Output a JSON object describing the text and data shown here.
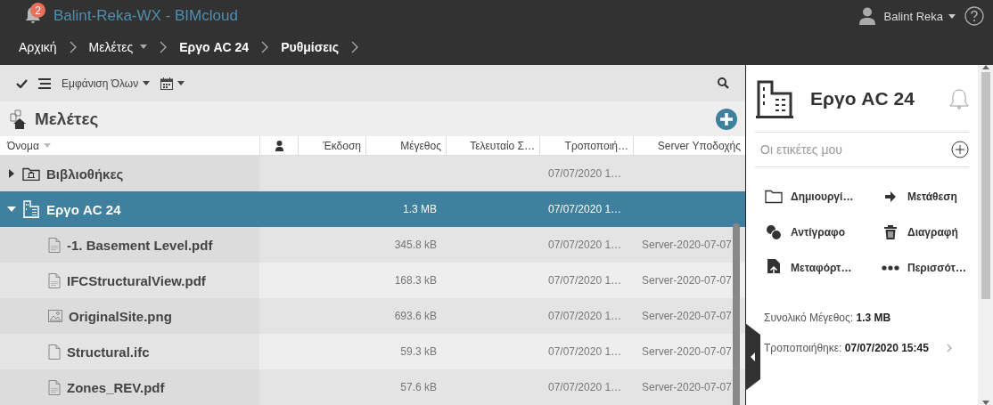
{
  "header": {
    "notification_count": "2",
    "title": "Balint-Reka-WX - BIMcloud",
    "user": "Balint Reka"
  },
  "breadcrumbs": [
    {
      "label": "Αρχική",
      "emphasized": false,
      "dropdown": false
    },
    {
      "label": "Μελέτες",
      "emphasized": false,
      "dropdown": true
    },
    {
      "label": "Εργο AC 24",
      "emphasized": true,
      "dropdown": false
    },
    {
      "label": "Ρυθμίσεις",
      "emphasized": true,
      "dropdown": false
    }
  ],
  "toolbar": {
    "filter": "Εμφάνιση Όλων"
  },
  "list": {
    "title": "Μελέτες",
    "columns": [
      {
        "kind": "text",
        "label": "Όνομα",
        "sorted": true
      },
      {
        "kind": "user"
      },
      {
        "kind": "text",
        "label": "Έκδοση",
        "sorted": false
      },
      {
        "kind": "text",
        "label": "Μέγεθος",
        "sorted": false
      },
      {
        "kind": "text",
        "label": "Τελευταίο Σ…",
        "sorted": false
      },
      {
        "kind": "text",
        "label": "Τροποποιή…",
        "sorted": false
      },
      {
        "kind": "text",
        "label": "Server Υποδοχής",
        "sorted": false
      }
    ],
    "rows": [
      {
        "kind": "library",
        "name": "Βιβλιοθήκες",
        "expanded": false,
        "selected": false,
        "modified": "07/07/2020 1…"
      },
      {
        "kind": "project",
        "name": "Εργο AC 24",
        "expanded": true,
        "selected": true,
        "size": "1.3 MB",
        "modified": "07/07/2020 1…",
        "children": [
          {
            "kind": "pdf",
            "name": "-1. Basement Level.pdf",
            "selected": false,
            "size": "345.8 kB",
            "modified": "07/07/2020 1…",
            "server": "Server-2020-07-07"
          },
          {
            "kind": "pdf",
            "name": "IFCStructuralView.pdf",
            "selected": false,
            "size": "168.3 kB",
            "modified": "07/07/2020 1…",
            "server": "Server-2020-07-07"
          },
          {
            "kind": "image",
            "name": "OriginalSite.png",
            "selected": false,
            "size": "693.6 kB",
            "modified": "07/07/2020 1…",
            "server": "Server-2020-07-07"
          },
          {
            "kind": "file",
            "name": "Structural.ifc",
            "selected": false,
            "size": "59.3 kB",
            "modified": "07/07/2020 1…",
            "server": "Server-2020-07-07"
          },
          {
            "kind": "pdf",
            "name": "Zones_REV.pdf",
            "selected": false,
            "size": "57.6 kB",
            "modified": "07/07/2020 1…",
            "server": "Server-2020-07-07"
          }
        ]
      }
    ]
  },
  "details": {
    "title": "Εργο AC 24",
    "tags_placeholder": "Οι ετικέτες μου",
    "actions": [
      {
        "kind": "new-folder",
        "label": "Δημιουργί…"
      },
      {
        "kind": "move",
        "label": "Μετάθεση"
      },
      {
        "kind": "copy",
        "label": "Αντίγραφο"
      },
      {
        "kind": "delete",
        "label": "Διαγραφή"
      },
      {
        "kind": "upload",
        "label": "Μεταφόρτ…"
      },
      {
        "kind": "more",
        "label": "Περισσότ…"
      }
    ],
    "info": [
      {
        "label": "Συνολικό Μέγεθος:",
        "value": "1.3 MB",
        "link": false
      },
      {
        "label": "Τροποποιήθηκε:",
        "value": "07/07/2020 15:45",
        "link": true
      }
    ]
  }
}
